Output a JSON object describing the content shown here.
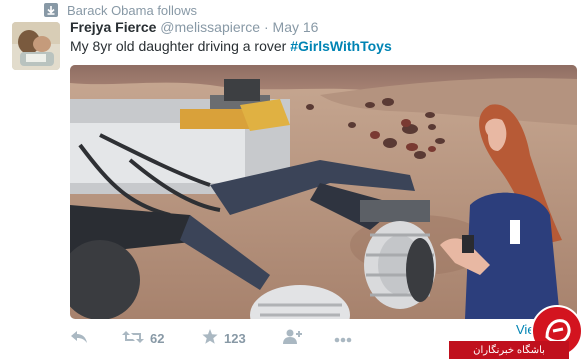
{
  "context": {
    "text": "Barack Obama follows",
    "icon": "follow-icon"
  },
  "tweet": {
    "author_name": "Frejya Fierce",
    "handle": "@melissapierce",
    "separator": "·",
    "timestamp": "May 16",
    "text_plain": "My 8yr old daughter driving a rover ",
    "hashtag": "#GirlsWithToys"
  },
  "media": {
    "type": "photo"
  },
  "actions": {
    "reply": {
      "icon": "reply-icon"
    },
    "retweet": {
      "icon": "retweet-icon",
      "count": "62"
    },
    "favorite": {
      "icon": "star-icon",
      "count": "123"
    },
    "follow": {
      "icon": "add-user-icon"
    },
    "more": {
      "icon": "more-icon"
    }
  },
  "view_more": "Vie",
  "watermark": {
    "text": "باشگاه خبرنگاران"
  },
  "colors": {
    "link": "#0084b4",
    "muted": "#8899a6",
    "text": "#292f33",
    "watermark": "#c0101d"
  }
}
